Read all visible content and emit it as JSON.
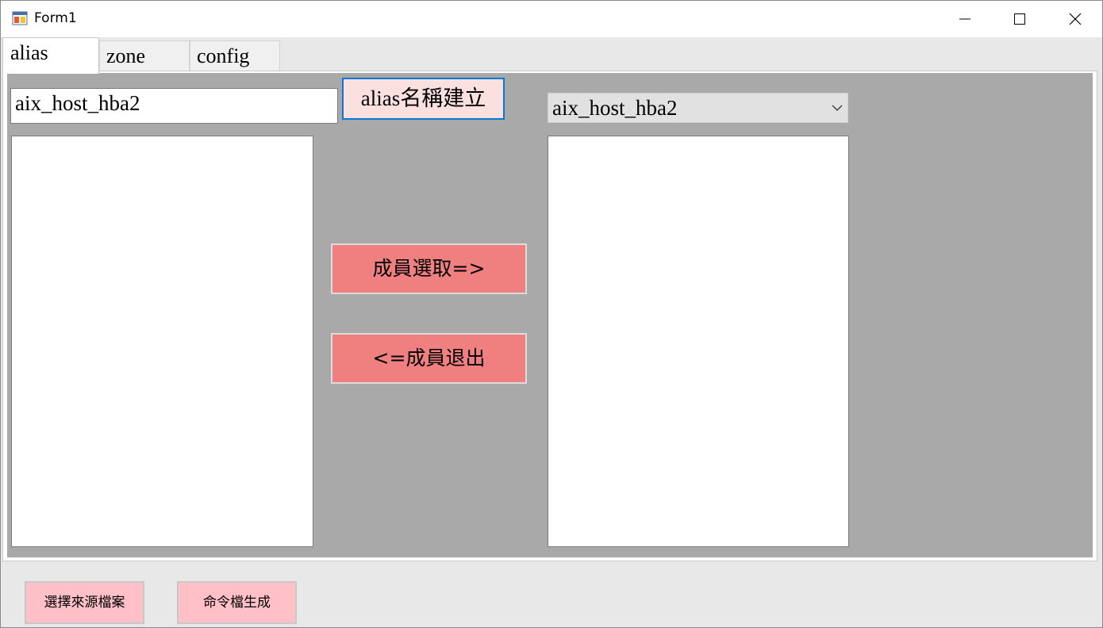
{
  "window": {
    "title": "Form1",
    "controls": {
      "minimize_icon": "minimize-icon",
      "maximize_icon": "maximize-icon",
      "close_icon": "close-icon"
    }
  },
  "tabs": [
    {
      "label": "alias",
      "active": true
    },
    {
      "label": "zone",
      "active": false
    },
    {
      "label": "config",
      "active": false
    }
  ],
  "alias_tab": {
    "alias_name_input": {
      "value": "aix_host_hba2"
    },
    "create_alias_button": "alias名稱建立",
    "alias_select": {
      "selected": "aix_host_hba2"
    },
    "add_member_button": "成員選取=>",
    "remove_member_button": "<=成員退出",
    "available_list": [],
    "member_list": []
  },
  "footer": {
    "select_source_button": "選擇來源檔案",
    "generate_command_button": "命令檔生成"
  },
  "colors": {
    "tabpage_bg": "#a9a9a9",
    "member_button": "#f07f7f",
    "create_button_border": "#0a78d7",
    "footer_button": "#ffc0c8"
  }
}
